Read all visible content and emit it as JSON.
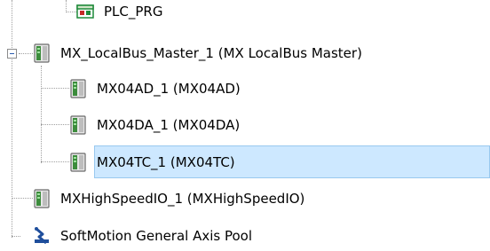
{
  "tree": {
    "items": [
      {
        "label": "PLC_PRG",
        "icon": "program-icon"
      },
      {
        "label": "MX_LocalBus_Master_1 (MX LocalBus Master)",
        "icon": "device-icon",
        "expanded": true
      },
      {
        "label": "MX04AD_1 (MX04AD)",
        "icon": "device-icon"
      },
      {
        "label": "MX04DA_1 (MX04DA)",
        "icon": "device-icon"
      },
      {
        "label": "MX04TC_1 (MX04TC)",
        "icon": "device-icon",
        "selected": true
      },
      {
        "label": "MXHighSpeedIO_1 (MXHighSpeedIO)",
        "icon": "device-icon"
      },
      {
        "label": "SoftMotion General Axis Pool",
        "icon": "axis-pool-icon"
      }
    ]
  },
  "colors": {
    "selection_bg": "#cde8ff",
    "selection_border": "#99c9ef",
    "guide_line": "#a0a0a0",
    "device_green": "#3c8c3c"
  }
}
